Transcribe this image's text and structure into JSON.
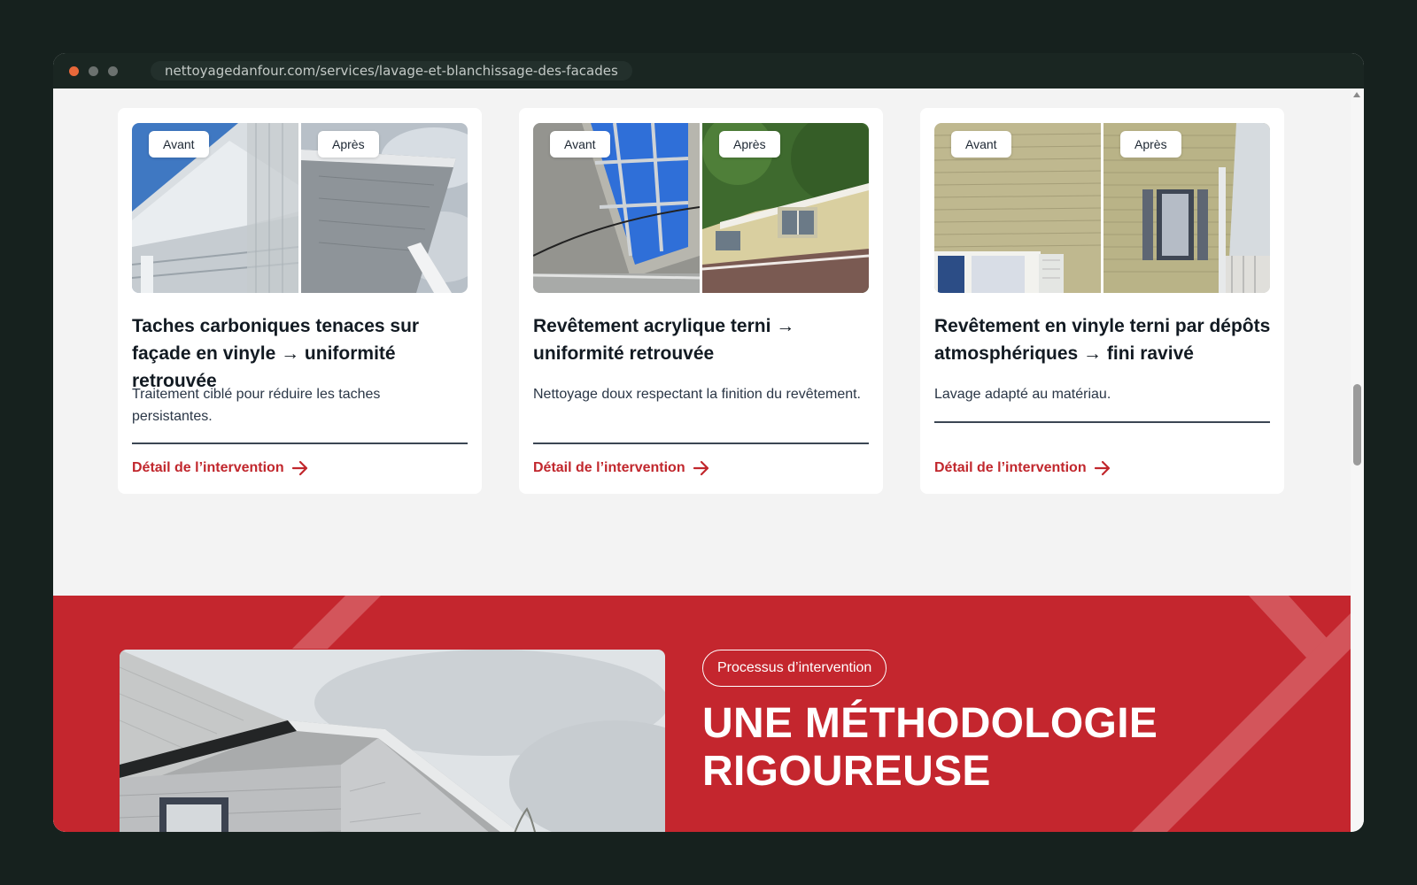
{
  "browser": {
    "url": "nettoyagedanfour.com/services/lavage-et-blanchissage-des-facades"
  },
  "cards": [
    {
      "before_label": "Avant",
      "after_label": "Après",
      "title": "Taches carboniques tenaces sur façade en vinyle → uniformité retrouvée",
      "description": "Traitement ciblé pour réduire les taches persistantes.",
      "link": "Détail de l’intervention",
      "link_icon": "arrow-right-icon"
    },
    {
      "before_label": "Avant",
      "after_label": "Après",
      "title": "Revêtement acrylique terni → uniformité retrouvée",
      "description": "Nettoyage doux respectant la finition du revêtement.",
      "link": "Détail de l’intervention",
      "link_icon": "arrow-right-icon"
    },
    {
      "before_label": "Avant",
      "after_label": "Après",
      "title": "Revêtement en vinyle terni par dépôts atmosphériques → fini ravivé",
      "description": "Lavage adapté au matériau.",
      "link": "Détail de l’intervention",
      "link_icon": "arrow-right-icon"
    }
  ],
  "process_section": {
    "badge": "Processus d’intervention",
    "heading": "UNE MÉTHODOLOGIE RIGOUREUSE"
  },
  "colors": {
    "accent_red": "#c4262e",
    "link_red": "#c1272d",
    "page_background": "#f3f3f3",
    "window_frame": "#16211e"
  }
}
